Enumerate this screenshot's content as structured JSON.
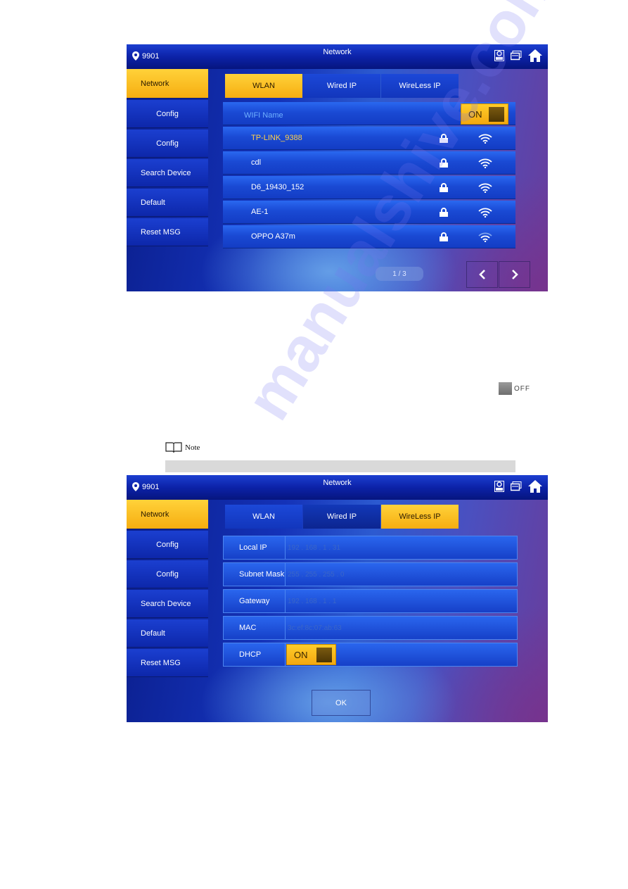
{
  "colors": {
    "accent_yellow": "#f6ad10",
    "panel_blue": "#1a4ad4",
    "highlight_text": "#ffd24a",
    "header_text": "#6fb0ff"
  },
  "screen1": {
    "location": "9901",
    "title": "Network",
    "top_icons": [
      "monitor-device-icon",
      "screens-icon",
      "home-icon"
    ],
    "sidebar": [
      {
        "label": "Network",
        "active": true
      },
      {
        "label": "Config"
      },
      {
        "label": "Config"
      },
      {
        "label": "Search Device"
      },
      {
        "label": "Default"
      },
      {
        "label": "Reset MSG"
      }
    ],
    "tabs": [
      {
        "label": "WLAN",
        "active": true
      },
      {
        "label": "Wired IP"
      },
      {
        "label": "WireLess IP"
      }
    ],
    "wifi_header": "WIFI Name",
    "wifi_toggle": "ON",
    "networks": [
      {
        "name": "TP-LINK_9388",
        "connected": true,
        "locked": true,
        "signal": "strong"
      },
      {
        "name": "cdl",
        "locked": true,
        "signal": "strong"
      },
      {
        "name": "D6_19430_152",
        "locked": true,
        "signal": "strong"
      },
      {
        "name": "AE-1",
        "locked": true,
        "signal": "strong"
      },
      {
        "name": "OPPO A37m",
        "locked": true,
        "signal": "medium"
      }
    ],
    "pager": "1 / 3",
    "prev_label": "‹",
    "next_label": "›"
  },
  "doc": {
    "off_indicator": "OFF",
    "note_label": "Note",
    "watermark": "manualshive.com"
  },
  "screen2": {
    "location": "9901",
    "title": "Network",
    "sidebar": [
      {
        "label": "Network",
        "active": true
      },
      {
        "label": "Config"
      },
      {
        "label": "Config"
      },
      {
        "label": "Search Device"
      },
      {
        "label": "Default"
      },
      {
        "label": "Reset MSG"
      }
    ],
    "tabs": [
      {
        "label": "WLAN"
      },
      {
        "label": "Wired IP"
      },
      {
        "label": "WireLess IP",
        "active": true
      }
    ],
    "fields": [
      {
        "label": "Local IP",
        "value": "192 . 168 . 1 . 31"
      },
      {
        "label": "Subnet Mask",
        "value": "255 . 255 . 255 . 0"
      },
      {
        "label": "Gateway",
        "value": "192 . 168 . 1 . 1"
      },
      {
        "label": "MAC",
        "value": "3c:ef:8c:07:ab:63"
      }
    ],
    "dhcp_label": "DHCP",
    "dhcp_toggle": "ON",
    "ok_label": "OK"
  }
}
